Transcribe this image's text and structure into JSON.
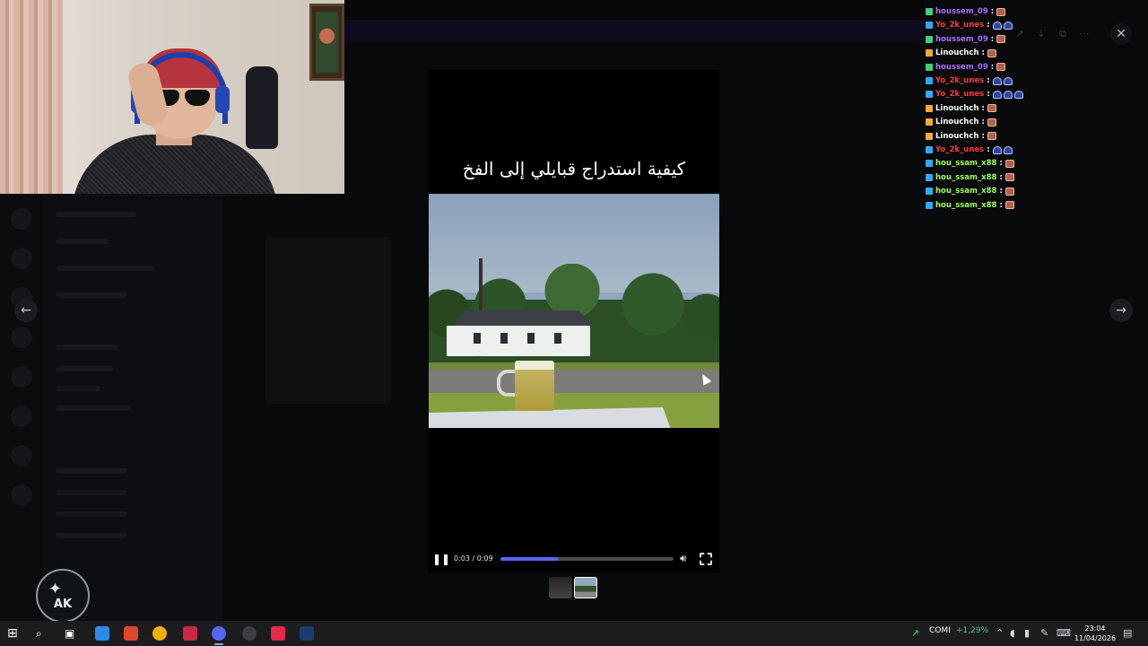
{
  "viewer": {
    "video_title": "كيفية استدراج قبايلي إلى الفخ",
    "time_display": "0:03 / 0:09",
    "progress_fraction": 0.33,
    "icons": {
      "close": "close-icon",
      "prev": "arrow-left-icon",
      "next": "arrow-right-icon",
      "pause": "pause-icon",
      "volume": "volume-icon",
      "fullscreen": "fullscreen-icon"
    }
  },
  "chat": {
    "messages": [
      {
        "user": "houssem_09",
        "color": "#a970ff",
        "badge": "#3fd07a",
        "emotes": [
          "red"
        ]
      },
      {
        "user": "Yo_2k_unes",
        "color": "#ff3b3b",
        "badge": "#2fa9ff",
        "emotes": [
          "blue",
          "blue"
        ]
      },
      {
        "user": "houssem_09",
        "color": "#a970ff",
        "badge": "#3fd07a",
        "emotes": [
          "red"
        ]
      },
      {
        "user": "Linouchch",
        "color": "#ffffff",
        "badge": "#f2a93b",
        "emotes": [
          "red"
        ]
      },
      {
        "user": "houssem_09",
        "color": "#a970ff",
        "badge": "#3fd07a",
        "emotes": [
          "red"
        ]
      },
      {
        "user": "Yo_2k_unes",
        "color": "#ff3b3b",
        "badge": "#2fa9ff",
        "emotes": [
          "blue",
          "blue"
        ]
      },
      {
        "user": "Yo_2k_unes",
        "color": "#ff3b3b",
        "badge": "#2fa9ff",
        "emotes": [
          "blue",
          "blue",
          "blue"
        ]
      },
      {
        "user": "Linouchch",
        "color": "#ffffff",
        "badge": "#f2a93b",
        "emotes": [
          "red"
        ]
      },
      {
        "user": "Linouchch",
        "color": "#ffffff",
        "badge": "#f2a93b",
        "emotes": [
          "red"
        ]
      },
      {
        "user": "Linouchch",
        "color": "#ffffff",
        "badge": "#f2a93b",
        "emotes": [
          "red"
        ]
      },
      {
        "user": "Yo_2k_unes",
        "color": "#ff3b3b",
        "badge": "#2fa9ff",
        "emotes": [
          "blue",
          "blue"
        ]
      },
      {
        "user": "hou_ssam_x88",
        "color": "#9cff5a",
        "badge": "#2fa9ff",
        "emotes": [
          "red"
        ]
      },
      {
        "user": "hou_ssam_x88",
        "color": "#9cff5a",
        "badge": "#2fa9ff",
        "emotes": [
          "red"
        ]
      },
      {
        "user": "hou_ssam_x88",
        "color": "#9cff5a",
        "badge": "#2fa9ff",
        "emotes": [
          "red"
        ]
      },
      {
        "user": "hou_ssam_x88",
        "color": "#9cff5a",
        "badge": "#2fa9ff",
        "emotes": [
          "red"
        ]
      }
    ],
    "separator": ":"
  },
  "taskbar": {
    "stock_name": "COMI",
    "stock_change": "+1,29%",
    "time": "23:04",
    "date": "11/04/2026"
  },
  "colors": {
    "accent": "#5865f2",
    "stock_up": "#3fd07a"
  }
}
